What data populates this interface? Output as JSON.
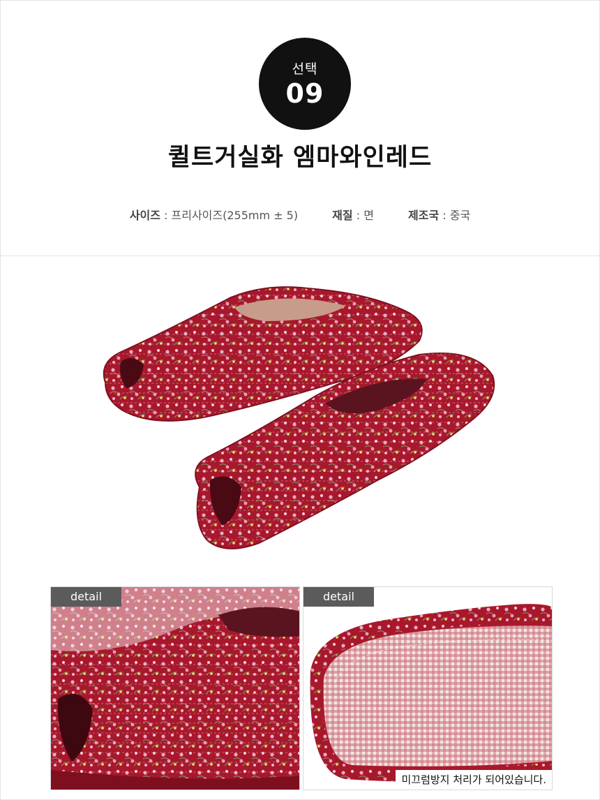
{
  "badge": {
    "label": "선택",
    "number": "09"
  },
  "product": {
    "title": "퀼트거실화 엠마와인레드"
  },
  "specs": [
    {
      "key": "사이즈",
      "separator": " : ",
      "value": "프리사이즈(255mm ± 5)"
    },
    {
      "key": "재질",
      "separator": " : ",
      "value": "면"
    },
    {
      "key": "제조국",
      "separator": " : ",
      "value": "중국"
    }
  ],
  "details": [
    {
      "tag": "detail"
    },
    {
      "tag": "detail",
      "caption": "미끄럼방지 처리가 되어있습니다."
    }
  ],
  "colors": {
    "badge": "#111111",
    "fabric": "#a8182c",
    "fabric_dark": "#7e0f1f",
    "tag": "#5b5b5b",
    "border": "#e3e3e3"
  }
}
